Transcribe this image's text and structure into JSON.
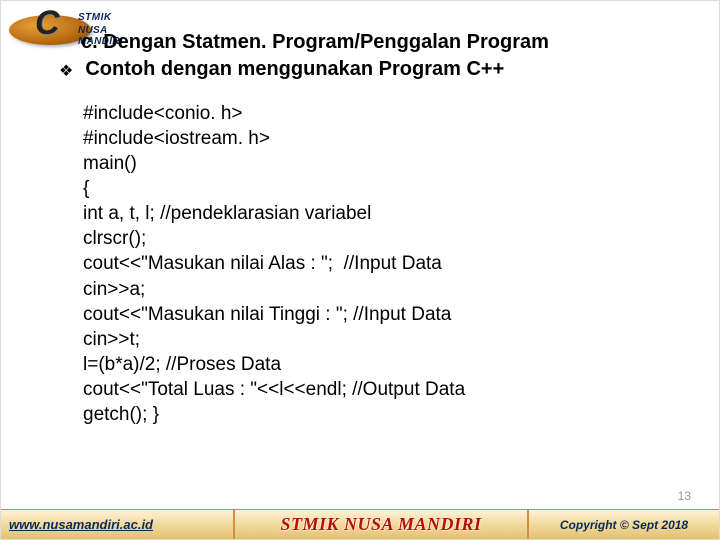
{
  "logo": {
    "letter": "C",
    "line1": "STMIK",
    "line2": "NUSA MANDIRI"
  },
  "heading": {
    "line1": "c. Dengan Statmen. Program/Penggalan Program",
    "line2": "Contoh dengan menggunakan Program C++"
  },
  "code": [
    "#include<conio. h>",
    "#include<iostream. h>",
    "main()",
    "{",
    "int a, t, l; //pendeklarasian variabel",
    "clrscr();",
    "cout<<\"Masukan nilai Alas : \";  //Input Data",
    "cin>>a;",
    "cout<<\"Masukan nilai Tinggi : \"; //Input Data",
    "cin>>t;",
    "l=(b*a)/2; //Proses Data",
    "cout<<\"Total Luas : \"<<l<<endl; //Output Data",
    "getch(); }"
  ],
  "footer": {
    "url": "www.nusamandiri.ac.id",
    "center": "STMIK NUSA MANDIRI",
    "copyright": "Copyright © Sept  2018"
  },
  "slide_number": "13"
}
